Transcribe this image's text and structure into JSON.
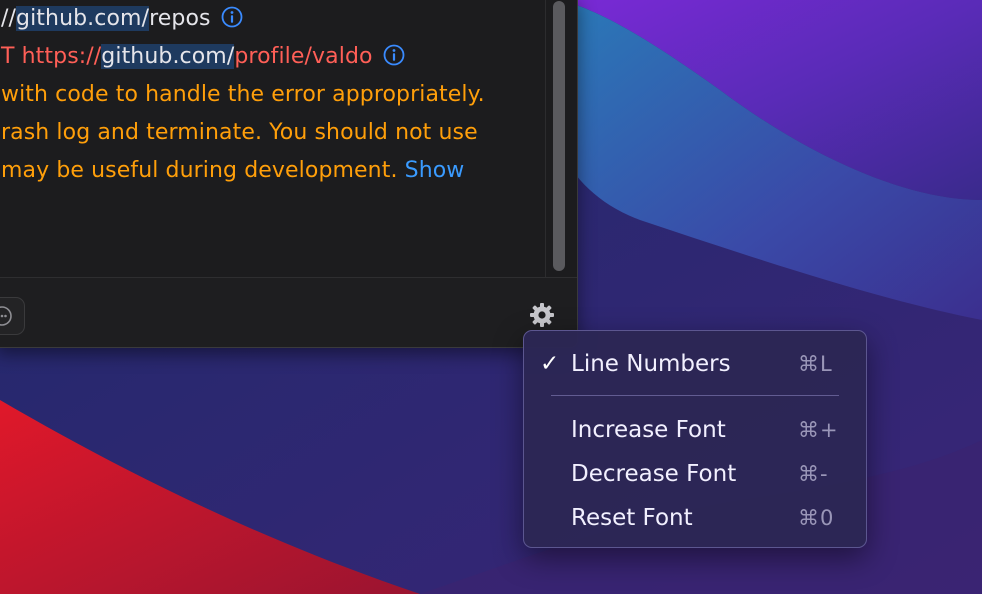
{
  "log": {
    "line1": {
      "prefix": "//",
      "host": "github.com/",
      "path": "repos",
      "info_icon": "info-circle-icon"
    },
    "line2": {
      "prefix": "T https://",
      "host": "github.com/",
      "path": "profile/valdo",
      "info_icon": "info-circle-icon"
    },
    "line3": "with code to handle the error appropriately.",
    "line4": "rash log and terminate. You should not use",
    "line5": {
      "text": "may be useful during development. ",
      "link": "Show"
    }
  },
  "footer": {
    "more_icon": "ellipsis-circle-icon",
    "settings_icon": "gear-icon"
  },
  "menu": {
    "items": [
      {
        "label": "Line Numbers",
        "shortcut": "⌘L",
        "checked": true
      },
      {
        "label": "Increase Font",
        "shortcut": "⌘+"
      },
      {
        "label": "Decrease Font",
        "shortcut": "⌘-"
      },
      {
        "label": "Reset Font",
        "shortcut": "⌘0"
      }
    ]
  },
  "colors": {
    "error_text": "#ff5f57",
    "warning_text": "#ff9f0a",
    "link": "#3a9bff",
    "menu_bg": "#2c2654"
  }
}
